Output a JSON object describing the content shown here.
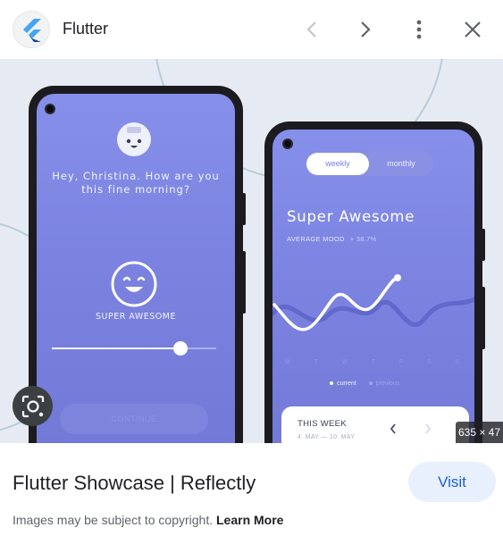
{
  "header": {
    "site_name": "Flutter",
    "logo_icon": "flutter-logo-icon",
    "prev_icon": "chevron-left-icon",
    "next_icon": "chevron-right-icon",
    "more_icon": "more-vert-icon",
    "close_icon": "close-icon"
  },
  "preview": {
    "left_phone": {
      "greeting_line1": "Hey, Christina. How are you",
      "greeting_line2": "this fine morning?",
      "mood_label": "SUPER AWESOME",
      "slider_value": 0.78,
      "continue_label": "CONTINUE"
    },
    "right_phone": {
      "toggle_weekly": "weekly",
      "toggle_monthly": "monthly",
      "title": "Super Awesome",
      "average_mood_label": "AVERAGE MOOD",
      "average_mood_value": "+ 38.7%",
      "days": [
        "M",
        "T",
        "W",
        "T",
        "F",
        "S",
        "S"
      ],
      "legend_current": "current",
      "legend_previous": "previous",
      "week_title": "THIS WEEK",
      "week_range": "4. MAY — 10. MAY"
    },
    "dimensions": "635 × 47",
    "lens_icon": "google-lens-icon"
  },
  "result": {
    "title": "Flutter Showcase | Reflectly",
    "visit_label": "Visit"
  },
  "footer": {
    "copyright_text": "Images may be subject to copyright.",
    "learn_more": "Learn More"
  },
  "colors": {
    "accent": "#1a5fcc",
    "visit_bg": "#e8f0fe",
    "screen_purple": "#7b82e0"
  }
}
